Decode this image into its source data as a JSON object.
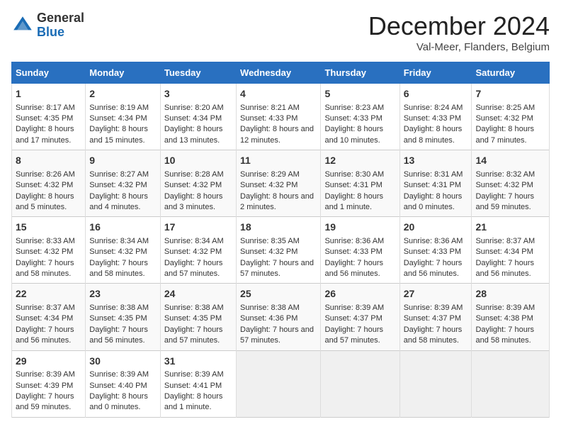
{
  "header": {
    "logo_general": "General",
    "logo_blue": "Blue",
    "month_title": "December 2024",
    "subtitle": "Val-Meer, Flanders, Belgium"
  },
  "days_of_week": [
    "Sunday",
    "Monday",
    "Tuesday",
    "Wednesday",
    "Thursday",
    "Friday",
    "Saturday"
  ],
  "weeks": [
    [
      {
        "day": "1",
        "content": "Sunrise: 8:17 AM\nSunset: 4:35 PM\nDaylight: 8 hours and 17 minutes."
      },
      {
        "day": "2",
        "content": "Sunrise: 8:19 AM\nSunset: 4:34 PM\nDaylight: 8 hours and 15 minutes."
      },
      {
        "day": "3",
        "content": "Sunrise: 8:20 AM\nSunset: 4:34 PM\nDaylight: 8 hours and 13 minutes."
      },
      {
        "day": "4",
        "content": "Sunrise: 8:21 AM\nSunset: 4:33 PM\nDaylight: 8 hours and 12 minutes."
      },
      {
        "day": "5",
        "content": "Sunrise: 8:23 AM\nSunset: 4:33 PM\nDaylight: 8 hours and 10 minutes."
      },
      {
        "day": "6",
        "content": "Sunrise: 8:24 AM\nSunset: 4:33 PM\nDaylight: 8 hours and 8 minutes."
      },
      {
        "day": "7",
        "content": "Sunrise: 8:25 AM\nSunset: 4:32 PM\nDaylight: 8 hours and 7 minutes."
      }
    ],
    [
      {
        "day": "8",
        "content": "Sunrise: 8:26 AM\nSunset: 4:32 PM\nDaylight: 8 hours and 5 minutes."
      },
      {
        "day": "9",
        "content": "Sunrise: 8:27 AM\nSunset: 4:32 PM\nDaylight: 8 hours and 4 minutes."
      },
      {
        "day": "10",
        "content": "Sunrise: 8:28 AM\nSunset: 4:32 PM\nDaylight: 8 hours and 3 minutes."
      },
      {
        "day": "11",
        "content": "Sunrise: 8:29 AM\nSunset: 4:32 PM\nDaylight: 8 hours and 2 minutes."
      },
      {
        "day": "12",
        "content": "Sunrise: 8:30 AM\nSunset: 4:31 PM\nDaylight: 8 hours and 1 minute."
      },
      {
        "day": "13",
        "content": "Sunrise: 8:31 AM\nSunset: 4:31 PM\nDaylight: 8 hours and 0 minutes."
      },
      {
        "day": "14",
        "content": "Sunrise: 8:32 AM\nSunset: 4:32 PM\nDaylight: 7 hours and 59 minutes."
      }
    ],
    [
      {
        "day": "15",
        "content": "Sunrise: 8:33 AM\nSunset: 4:32 PM\nDaylight: 7 hours and 58 minutes."
      },
      {
        "day": "16",
        "content": "Sunrise: 8:34 AM\nSunset: 4:32 PM\nDaylight: 7 hours and 58 minutes."
      },
      {
        "day": "17",
        "content": "Sunrise: 8:34 AM\nSunset: 4:32 PM\nDaylight: 7 hours and 57 minutes."
      },
      {
        "day": "18",
        "content": "Sunrise: 8:35 AM\nSunset: 4:32 PM\nDaylight: 7 hours and 57 minutes."
      },
      {
        "day": "19",
        "content": "Sunrise: 8:36 AM\nSunset: 4:33 PM\nDaylight: 7 hours and 56 minutes."
      },
      {
        "day": "20",
        "content": "Sunrise: 8:36 AM\nSunset: 4:33 PM\nDaylight: 7 hours and 56 minutes."
      },
      {
        "day": "21",
        "content": "Sunrise: 8:37 AM\nSunset: 4:34 PM\nDaylight: 7 hours and 56 minutes."
      }
    ],
    [
      {
        "day": "22",
        "content": "Sunrise: 8:37 AM\nSunset: 4:34 PM\nDaylight: 7 hours and 56 minutes."
      },
      {
        "day": "23",
        "content": "Sunrise: 8:38 AM\nSunset: 4:35 PM\nDaylight: 7 hours and 56 minutes."
      },
      {
        "day": "24",
        "content": "Sunrise: 8:38 AM\nSunset: 4:35 PM\nDaylight: 7 hours and 57 minutes."
      },
      {
        "day": "25",
        "content": "Sunrise: 8:38 AM\nSunset: 4:36 PM\nDaylight: 7 hours and 57 minutes."
      },
      {
        "day": "26",
        "content": "Sunrise: 8:39 AM\nSunset: 4:37 PM\nDaylight: 7 hours and 57 minutes."
      },
      {
        "day": "27",
        "content": "Sunrise: 8:39 AM\nSunset: 4:37 PM\nDaylight: 7 hours and 58 minutes."
      },
      {
        "day": "28",
        "content": "Sunrise: 8:39 AM\nSunset: 4:38 PM\nDaylight: 7 hours and 58 minutes."
      }
    ],
    [
      {
        "day": "29",
        "content": "Sunrise: 8:39 AM\nSunset: 4:39 PM\nDaylight: 7 hours and 59 minutes."
      },
      {
        "day": "30",
        "content": "Sunrise: 8:39 AM\nSunset: 4:40 PM\nDaylight: 8 hours and 0 minutes."
      },
      {
        "day": "31",
        "content": "Sunrise: 8:39 AM\nSunset: 4:41 PM\nDaylight: 8 hours and 1 minute."
      },
      {
        "day": "",
        "content": ""
      },
      {
        "day": "",
        "content": ""
      },
      {
        "day": "",
        "content": ""
      },
      {
        "day": "",
        "content": ""
      }
    ]
  ]
}
